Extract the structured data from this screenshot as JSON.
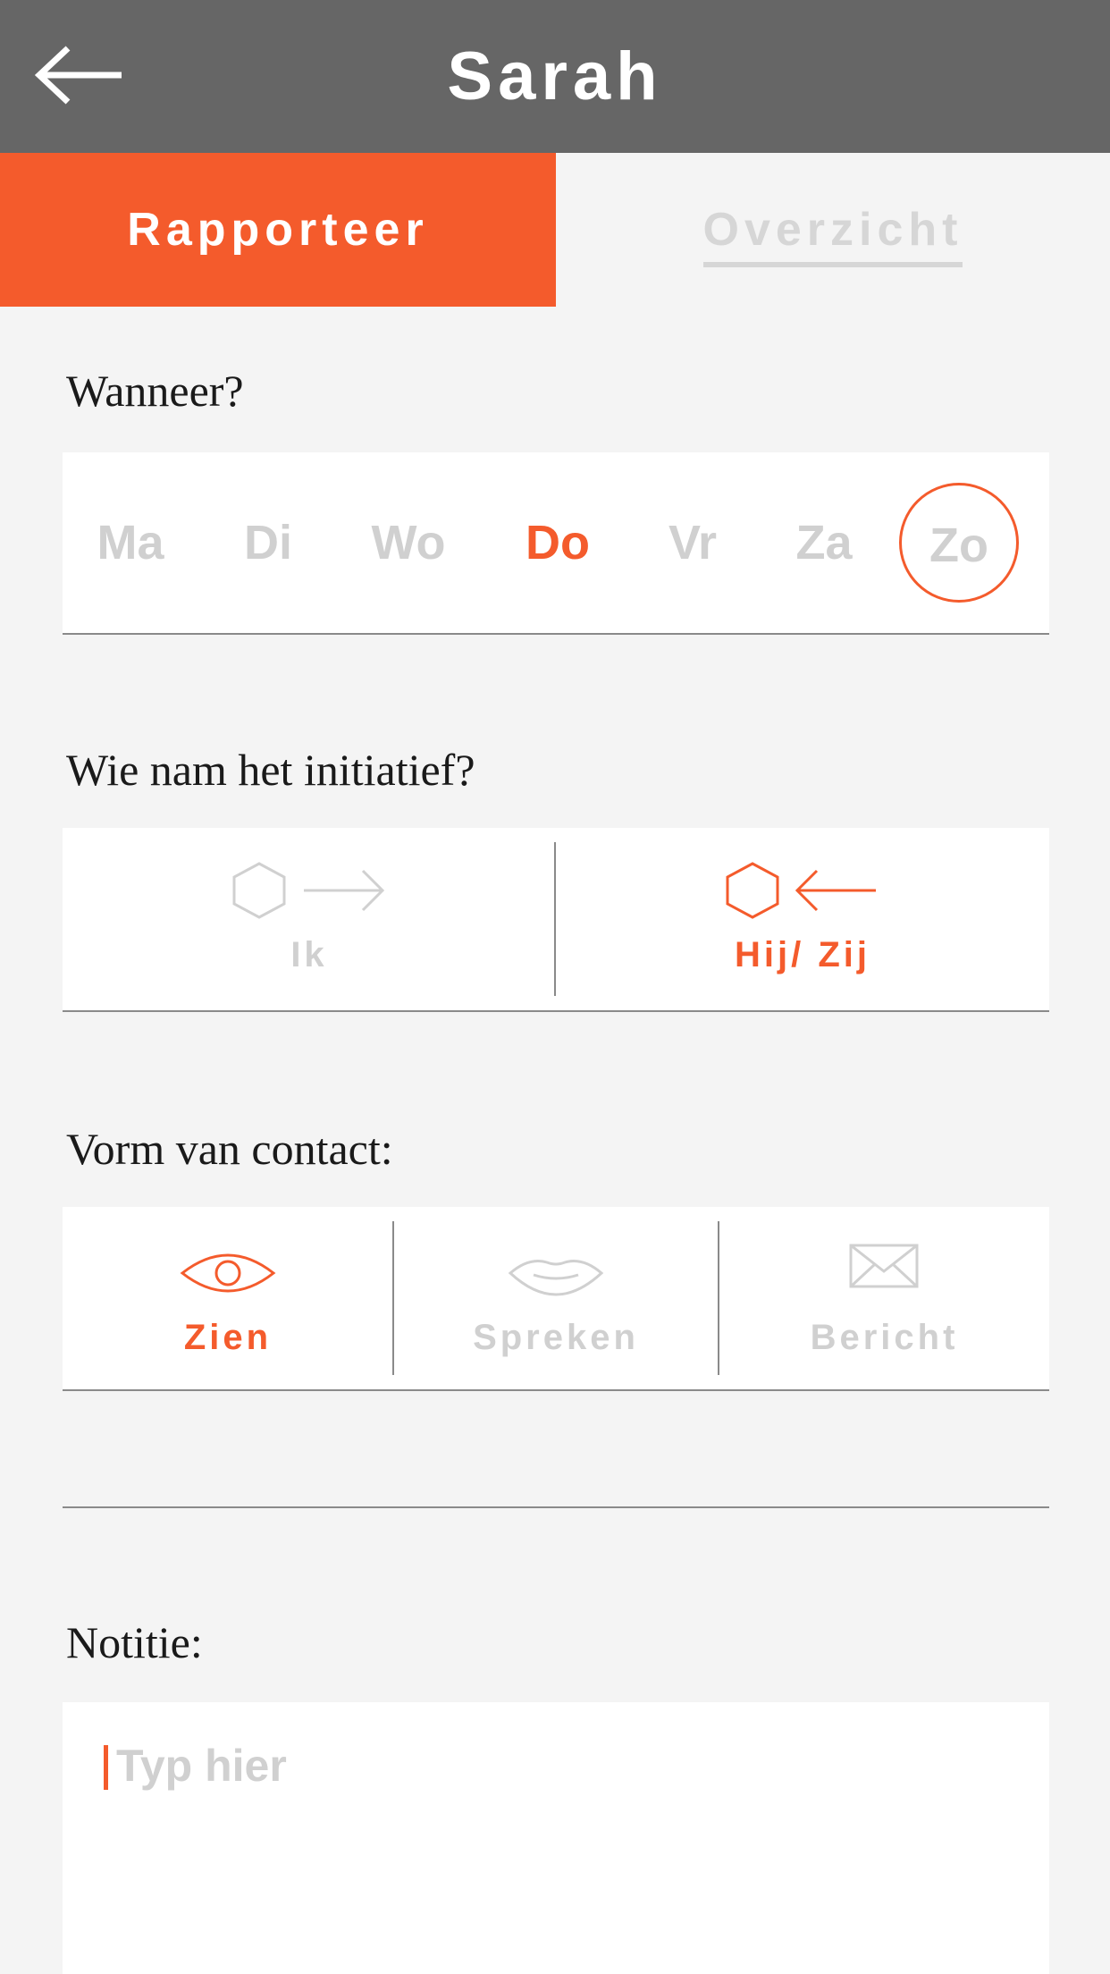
{
  "header": {
    "title": "Sarah",
    "back_icon": "arrow-left-icon"
  },
  "tabs": [
    {
      "label": "Rapporteer",
      "active": true
    },
    {
      "label": "Overzicht",
      "active": false
    }
  ],
  "when": {
    "label": "Wanneer?",
    "days": [
      "Ma",
      "Di",
      "Wo",
      "Do",
      "Vr",
      "Za",
      "Zo"
    ],
    "selected": "Do",
    "today": "Zo"
  },
  "initiative": {
    "label": "Wie nam het initiatief?",
    "options": [
      {
        "label": "Ik",
        "icon": "hexagon-arrow-right-icon",
        "selected": false
      },
      {
        "label": "Hij/ Zij",
        "icon": "hexagon-arrow-left-icon",
        "selected": true
      }
    ]
  },
  "contact": {
    "label": "Vorm van contact:",
    "options": [
      {
        "label": "Zien",
        "icon": "eye-icon",
        "selected": true
      },
      {
        "label": "Spreken",
        "icon": "lips-icon",
        "selected": false
      },
      {
        "label": "Bericht",
        "icon": "envelope-icon",
        "selected": false
      }
    ]
  },
  "note": {
    "label": "Notitie:",
    "placeholder": "Typ hier"
  },
  "colors": {
    "accent": "#f45b2c",
    "header": "#666666",
    "muted": "#d0d0d0",
    "background": "#f4f4f4"
  }
}
